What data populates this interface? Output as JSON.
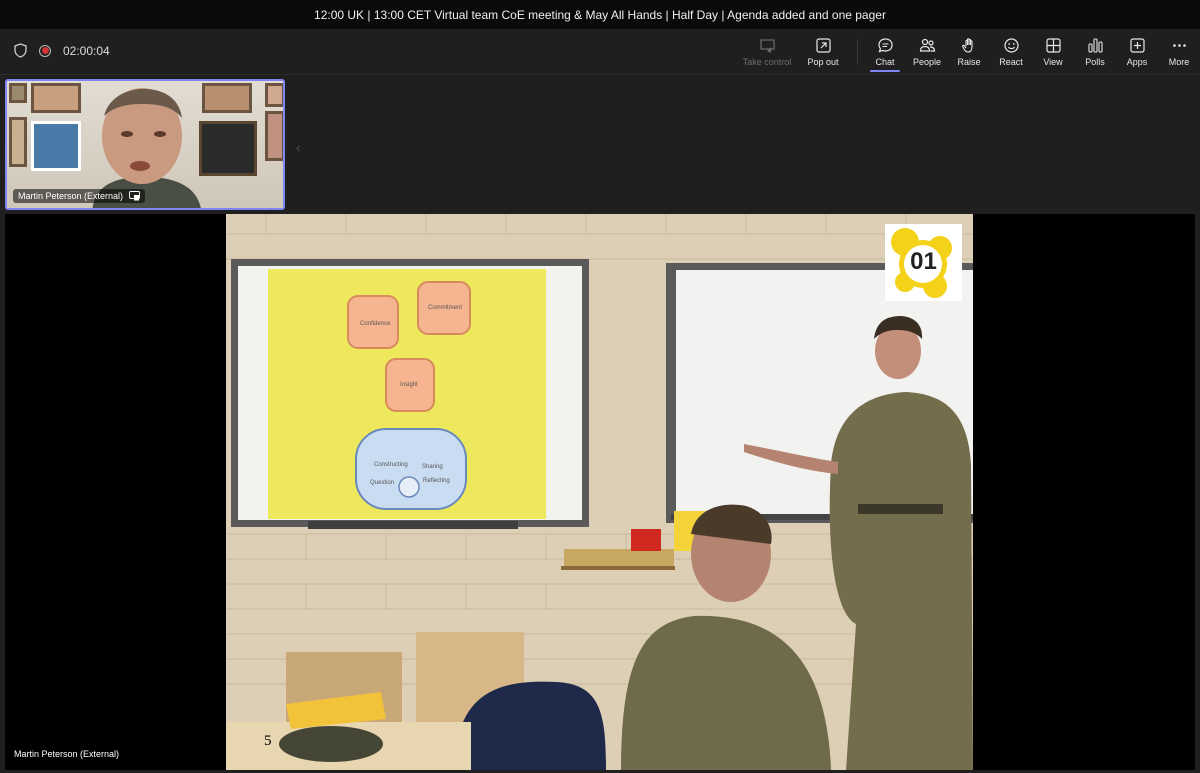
{
  "window": {
    "title": "12:00 UK | 13:00 CET Virtual team CoE meeting & May All Hands | Half Day | Agenda added and one pager"
  },
  "meeting": {
    "timer": "02:00:04"
  },
  "toolbar": {
    "take_control": "Take control",
    "pop_out": "Pop out",
    "chat": "Chat",
    "people": "People",
    "raise": "Raise",
    "react": "React",
    "view": "View",
    "polls": "Polls",
    "apps": "Apps",
    "more": "More"
  },
  "participants": {
    "self_tile_name": "Martin Peterson (External)",
    "shared_content_name": "Martin Peterson (External)"
  },
  "shared_image": {
    "badge_number": "01",
    "page_number": "5",
    "slide_words": [
      "Confidence",
      "Commitment",
      "Insight",
      "Constructing",
      "Sharing",
      "Question",
      "Reflecting"
    ]
  },
  "colors": {
    "accent": "#7f85f5",
    "record": "#d13438",
    "toolbar_bg": "#1f1f1f",
    "titlebar_bg": "#0a0a0a"
  }
}
